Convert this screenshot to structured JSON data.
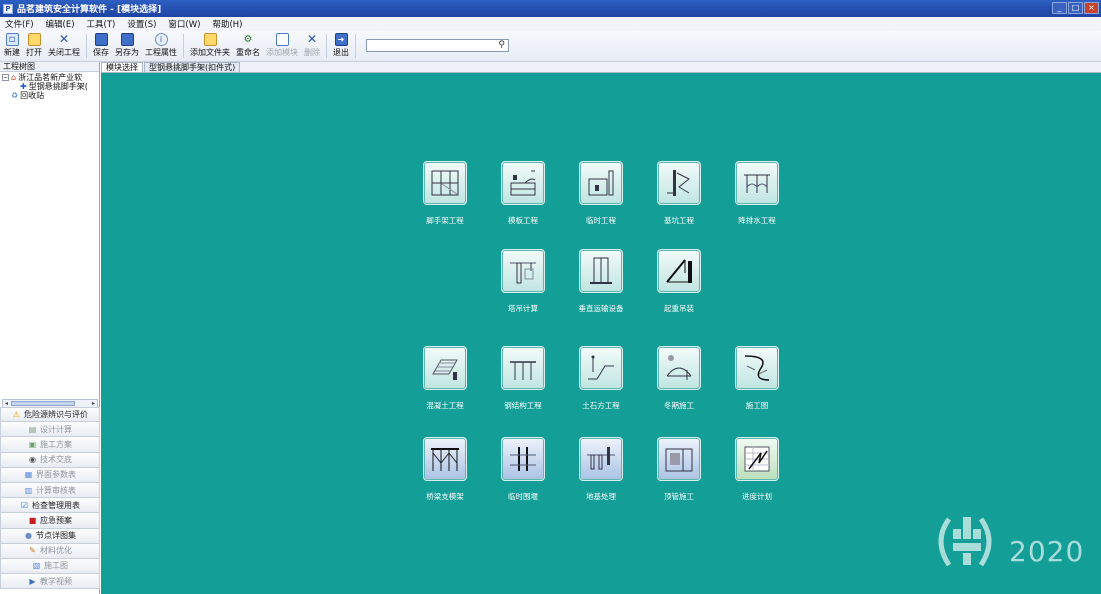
{
  "window": {
    "title": "品茗建筑安全计算软件 - [模块选择]",
    "icon": "app-logo-icon",
    "controls": [
      "minimize",
      "maximize",
      "close"
    ]
  },
  "menu": [
    "文件(F)",
    "编辑(E)",
    "工具(T)",
    "设置(S)",
    "窗口(W)",
    "帮助(H)"
  ],
  "toolbar": {
    "buttons": [
      {
        "label": "新建",
        "icon": "new-file-icon"
      },
      {
        "label": "打开",
        "icon": "open-folder-icon"
      },
      {
        "label": "关闭工程",
        "icon": "close-icon"
      },
      {
        "label": "保存",
        "icon": "save-icon"
      },
      {
        "label": "另存为",
        "icon": "save-as-icon"
      },
      {
        "label": "工程属性",
        "icon": "info-icon"
      },
      {
        "label": "添加文件夹",
        "icon": "add-folder-icon"
      },
      {
        "label": "重命名",
        "icon": "rename-icon"
      },
      {
        "label": "添加模块",
        "icon": "add-module-icon",
        "disabled": true
      },
      {
        "label": "删除",
        "icon": "delete-icon",
        "disabled": true
      },
      {
        "label": "退出",
        "icon": "exit-icon"
      }
    ],
    "search_value": "",
    "search_icon": "search-icon"
  },
  "left": {
    "panel_title": "工程树图",
    "tree": {
      "root": "浙江品茗新产业软",
      "child": "型钢悬挑脚手架(",
      "recycle": "回收站"
    },
    "accordion": [
      {
        "label": "危险源辨识与评价",
        "icon": "warning-icon",
        "active": true
      },
      {
        "label": "设计计算",
        "icon": "calc-icon"
      },
      {
        "label": "施工方案",
        "icon": "plan-icon"
      },
      {
        "label": "技术交底",
        "icon": "briefing-icon"
      },
      {
        "label": "界面参数表",
        "icon": "table-icon"
      },
      {
        "label": "计算审核表",
        "icon": "audit-icon"
      },
      {
        "label": "检查管理用表",
        "icon": "checklist-icon",
        "active": true
      },
      {
        "label": "应急预案",
        "icon": "emergency-icon",
        "active": true
      },
      {
        "label": "节点详图集",
        "icon": "detail-icon",
        "active": true
      },
      {
        "label": "材料优化",
        "icon": "material-icon"
      },
      {
        "label": "施工图",
        "icon": "drawing-icon"
      },
      {
        "label": "教学视频",
        "icon": "video-icon"
      }
    ]
  },
  "tabs": [
    "模块选择",
    "型钢悬挑脚手架(扣件式)"
  ],
  "modules": [
    {
      "label": "脚手架工程",
      "icon": "scaffold-icon"
    },
    {
      "label": "模板工程",
      "icon": "formwork-icon"
    },
    {
      "label": "临时工程",
      "icon": "temporary-works-icon"
    },
    {
      "label": "基坑工程",
      "icon": "foundation-pit-icon"
    },
    {
      "label": "降排水工程",
      "icon": "dewatering-icon"
    },
    {
      "label": "塔吊计算",
      "icon": "tower-crane-icon"
    },
    {
      "label": "垂直运输设备",
      "icon": "vertical-transport-icon"
    },
    {
      "label": "起重吊装",
      "icon": "lifting-icon"
    },
    {
      "label": "混凝土工程",
      "icon": "concrete-icon"
    },
    {
      "label": "钢结构工程",
      "icon": "steel-structure-icon"
    },
    {
      "label": "土石方工程",
      "icon": "earthwork-icon"
    },
    {
      "label": "冬期施工",
      "icon": "winter-construction-icon"
    },
    {
      "label": "施工图",
      "icon": "construction-drawing-icon"
    },
    {
      "label": "桥梁支模架",
      "icon": "bridge-formwork-icon"
    },
    {
      "label": "临时围堰",
      "icon": "cofferdam-icon"
    },
    {
      "label": "地基处理",
      "icon": "ground-treatment-icon"
    },
    {
      "label": "顶管施工",
      "icon": "pipe-jacking-icon"
    },
    {
      "label": "进度计划",
      "icon": "schedule-icon"
    }
  ],
  "watermark": {
    "year": "2020",
    "logo": "csc-logo-icon"
  },
  "colors": {
    "workspace": "#139e97",
    "titlebar": "#2250b4"
  }
}
